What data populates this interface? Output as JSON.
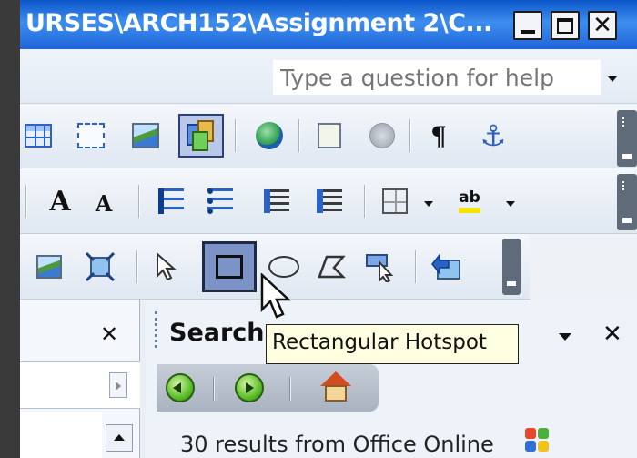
{
  "window": {
    "title": "URSES\\ARCH152\\Assignment 2\\C...",
    "minimize_label": "",
    "maximize_label": "",
    "close_label": "✕"
  },
  "help": {
    "placeholder": "Type a question for help"
  },
  "toolbar_format": {
    "pilcrow": "¶",
    "anchor": "⚓",
    "grow_font": "A",
    "shrink_font": "A",
    "highlight": "ab"
  },
  "tooltip": {
    "text": "Rectangular Hotspot"
  },
  "task_pane": {
    "title": "Search",
    "results_text": "30 results from Office Online"
  },
  "left_pane": {
    "close_label": "✕"
  },
  "icons": {
    "accent": "#2a62c8",
    "titlebar": "#1f66d8",
    "tooltip_bg": "#ffffe1"
  }
}
